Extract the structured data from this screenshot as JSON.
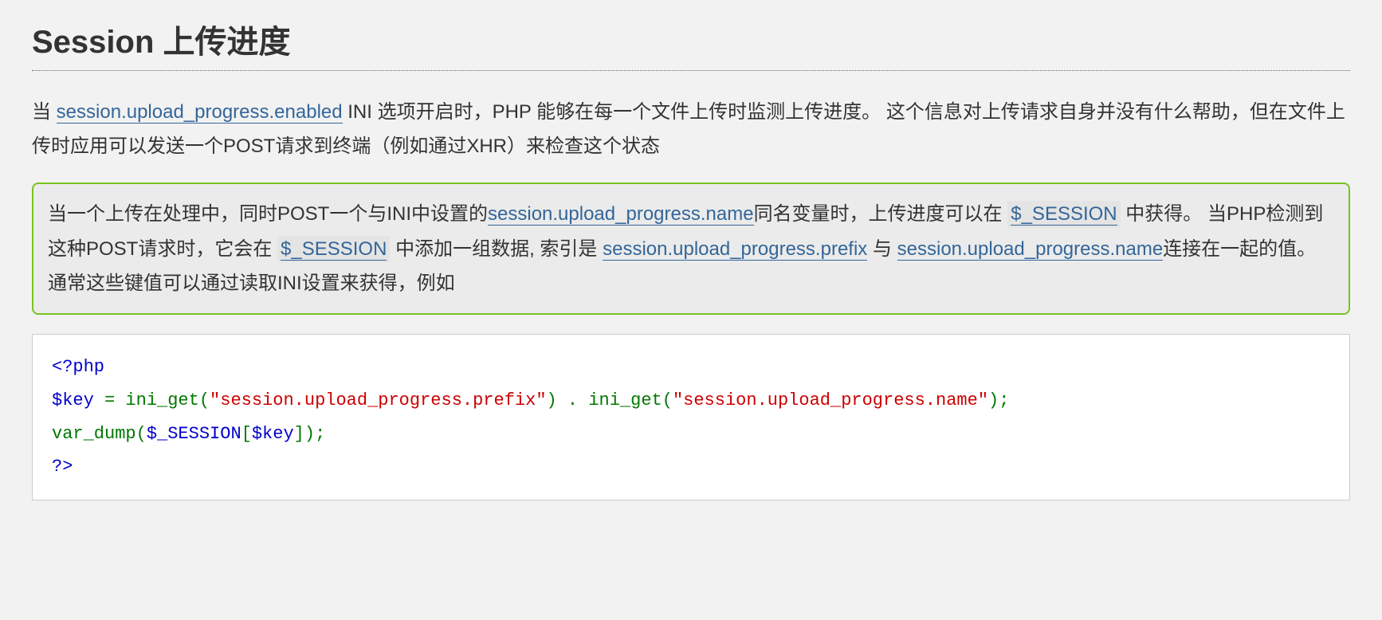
{
  "title": "Session 上传进度",
  "para1": {
    "t1": "当 ",
    "link1": "session.upload_progress.enabled",
    "t2": " INI 选项开启时，PHP 能够在每一个文件上传时监测上传进度。 这个信息对上传请求自身并没有什么帮助，但在文件上传时应用可以发送一个POST请求到终端（例如通过XHR）来检查这个状态"
  },
  "para2": {
    "t1": "当一个上传在处理中，同时POST一个与INI中设置的",
    "link1": "session.upload_progress.name",
    "t2": "同名变量时，上传进度可以在",
    "pill1": "$_SESSION",
    "t3": " 中获得。 当PHP检测到这种POST请求时，它会在 ",
    "pill2": "$_SESSION",
    "t4": " 中添加一组数据, 索引是 ",
    "link2": "session.upload_progress.prefix",
    "t5": " 与 ",
    "link3": "session.upload_progress.name",
    "t6": "连接在一起的值。 通常这些键值可以通过读取INI设置来获得，例如"
  },
  "code": {
    "open": "<?php",
    "l2_var": "$key ",
    "l2_eq": "= ",
    "l2_fn1": "ini_get",
    "l2_p1": "(",
    "l2_str1": "\"session.upload_progress.prefix\"",
    "l2_p2": ") . ",
    "l2_fn2": "ini_get",
    "l2_p3": "(",
    "l2_str2": "\"session.upload_progress.name\"",
    "l2_p4": ");",
    "l3_fn": "var_dump",
    "l3_p1": "(",
    "l3_var1": "$_SESSION",
    "l3_br1": "[",
    "l3_var2": "$key",
    "l3_br2": "]);",
    "close": "?>"
  }
}
